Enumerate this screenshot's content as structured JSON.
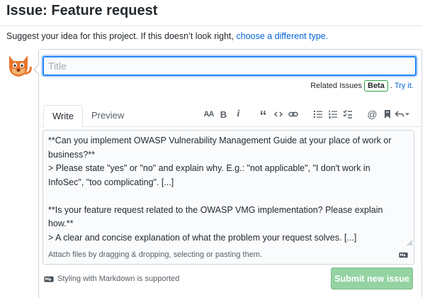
{
  "page": {
    "title": "Issue: Feature request",
    "subtitle_prefix": "Suggest your idea for this project. If this doesn’t look right,",
    "subtitle_link": "choose a different type."
  },
  "form": {
    "title_placeholder": "Title",
    "related_label": "Related Issues",
    "beta_badge": "Beta",
    "try_it_link": "Try it."
  },
  "tabs": [
    {
      "label": "Write",
      "active": true
    },
    {
      "label": "Preview",
      "active": false
    }
  ],
  "toolbar": {
    "icons": [
      "text-size-icon",
      "bold-icon",
      "italic-icon",
      "quote-icon",
      "code-icon",
      "link-icon",
      "unordered-list-icon",
      "ordered-list-icon",
      "task-list-icon",
      "mention-icon",
      "bookmark-icon",
      "reply-icon"
    ],
    "heading_glyph": "AA",
    "bold_glyph": "B",
    "italic_glyph": "i",
    "quote_glyph": "“",
    "mention_glyph": "@"
  },
  "editor": {
    "body": "**Can you implement OWASP Vulnerability Management Guide at your place of work or business?**\n> Please state \"yes\" or \"no\" and explain why. E.g.: \"not applicable\", \"I don't work in InfoSec\", \"too complicating\". [...]\n\n**Is your feature request related to the OWASP VMG implementation? Please explain how.**\n> A clear and concise explanation of what the problem your request solves. [...]"
  },
  "attach": {
    "hint": "Attach files by dragging & dropping, selecting or pasting them."
  },
  "footer": {
    "markdown_note": "Styling with Markdown is supported",
    "submit_label": "Submit new issue"
  },
  "colors": {
    "link": "#0366d6",
    "focus_border": "#2188ff",
    "submit_disabled": "#94d3a2",
    "beta_border": "#28a745"
  }
}
